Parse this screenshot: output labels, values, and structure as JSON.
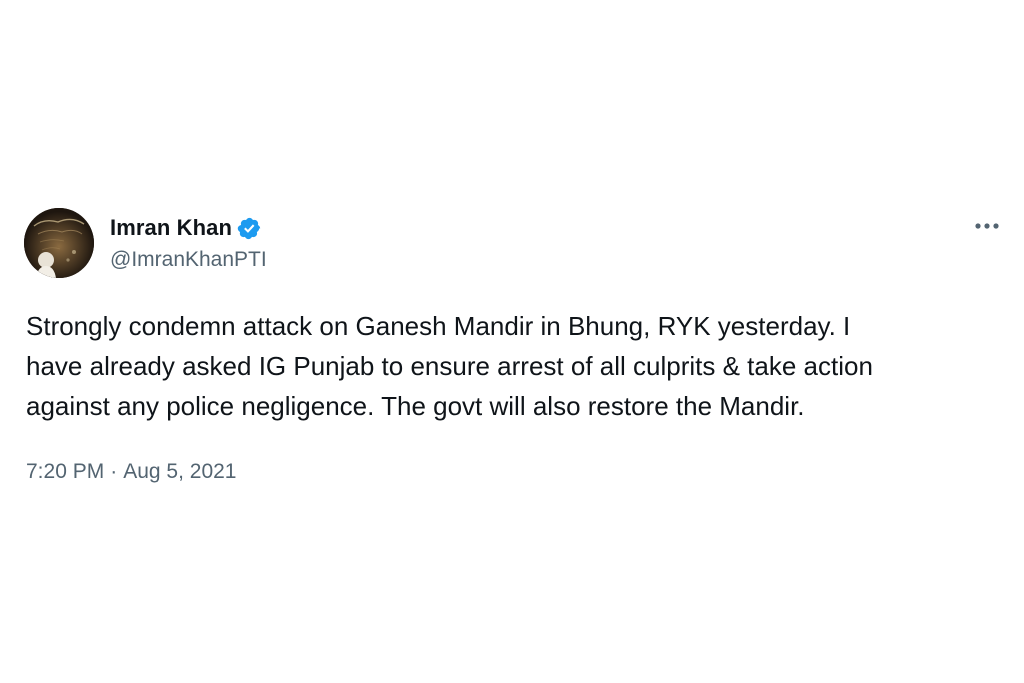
{
  "tweet": {
    "author": {
      "display_name": "Imran Khan",
      "handle": "@ImranKhanPTI",
      "verified": true,
      "avatar_icon": "profile-photo"
    },
    "more_icon": "ellipsis-icon",
    "text_lines": [
      "Strongly condemn attack on Ganesh Mandir in Bhung, RYK yesterday. I",
      "have already asked IG Punjab to ensure arrest of all culprits & take action",
      "against any police negligence. The govt will also restore the Mandir."
    ],
    "time": "7:20 PM",
    "separator": "·",
    "date": "Aug 5, 2021"
  },
  "colors": {
    "text_primary": "#0f1419",
    "text_secondary": "#536471",
    "verified_blue": "#1d9bf0",
    "background": "#ffffff"
  }
}
